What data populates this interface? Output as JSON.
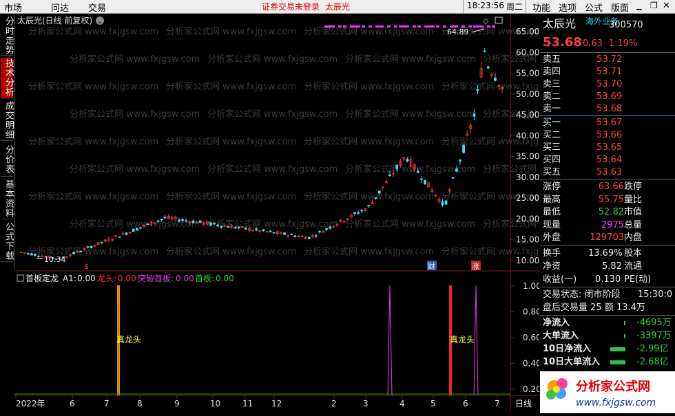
{
  "menu": {
    "left": [
      "市场",
      "问达",
      "交易"
    ],
    "notice": "证券交易未登录",
    "stock_name_top": "太辰光",
    "time": "18:23:56",
    "weekday": "周二",
    "right": [
      "功能",
      "选项",
      "公式",
      "版面"
    ]
  },
  "left_tabs": [
    "分时走势",
    "技术分析",
    "成交明细",
    "分价表",
    "基本资料",
    "公式下载"
  ],
  "chart": {
    "title": "太辰光(日线 前复权)",
    "max_label": "64.89",
    "min_label": "10.34",
    "y_ticks": [
      "65.00",
      "60.00",
      "55.00",
      "50.00",
      "45.00",
      "40.00",
      "35.00",
      "30.00",
      "25.00",
      "20.00",
      "15.00",
      "10.00"
    ],
    "markers": {
      "s": "$",
      "cai": "财",
      "zhang": "涨"
    },
    "watermark": "分析家公式网 www.fxjgsw.com",
    "indicator": {
      "name": "首板定龙",
      "a1_label": "A1:",
      "a1_value": "0.00",
      "longtou_label": "龙头:",
      "longtou_value": "0.00",
      "tupo_label": "突破首板:",
      "tupo_value": "0.00",
      "shouban_label": "首板:",
      "shouban_value": "0.00",
      "y_ticks": [
        "1.00",
        "0.80",
        "0.60",
        "0.40",
        "0.20"
      ],
      "event_label": "真龙头"
    },
    "x_ticks": [
      "2022年",
      "6",
      "7",
      "8",
      "9",
      "10",
      "11",
      "12",
      "2",
      "3",
      "4",
      "5",
      "6",
      "7"
    ],
    "period": "日线",
    "chart_data": {
      "type": "candlestick",
      "ylim": [
        9,
        66
      ],
      "price_max": 64.89,
      "price_min": 10.34,
      "dragon_events": 2
    }
  },
  "panel": {
    "name": "太辰光",
    "tag": "海外业务",
    "code": "300570",
    "price": "53.68",
    "change": "0.63",
    "change_pct": "1.19%",
    "sells": [
      {
        "label": "卖五",
        "price": "53.72"
      },
      {
        "label": "卖四",
        "price": "53.71"
      },
      {
        "label": "卖三",
        "price": "53.70"
      },
      {
        "label": "卖二",
        "price": "53.69"
      },
      {
        "label": "卖一",
        "price": "53.68"
      }
    ],
    "buys": [
      {
        "label": "买一",
        "price": "53.67"
      },
      {
        "label": "买二",
        "price": "53.66"
      },
      {
        "label": "买三",
        "price": "53.65"
      },
      {
        "label": "买四",
        "price": "53.64"
      },
      {
        "label": "买五",
        "price": "53.63"
      }
    ],
    "stats": [
      {
        "k": "涨停",
        "v": "63.66",
        "k2": "跌停"
      },
      {
        "k": "最高",
        "v": "55.75",
        "k2": "量比"
      },
      {
        "k": "最低",
        "v": "52.82",
        "k2": "市值"
      },
      {
        "k": "现量",
        "v": "2975",
        "k2": "总量"
      },
      {
        "k": "外盘",
        "v": "129703",
        "k2": "内盘"
      }
    ],
    "turnover": {
      "k": "换手",
      "v": "13.69%",
      "k2": "股本"
    },
    "netasset": {
      "k": "净资",
      "v": "5.82",
      "k2": "流通"
    },
    "eps": {
      "k": "收益(一)",
      "v": "0.130",
      "k2": "PE(动)"
    },
    "trade_state": "交易状态: 闭市阶段",
    "trade_time": "15:30:0",
    "after_hours": "盘后交易量 25 额 13.4万",
    "flows": [
      {
        "k": "净流入",
        "v": "-4695万"
      },
      {
        "k": "大单流入",
        "v": "-3397万"
      },
      {
        "k": "10日净流入",
        "v": "-2.99亿"
      },
      {
        "k": "10日大单流入",
        "v": "-2.68亿"
      }
    ]
  },
  "logo": {
    "name": "分析家公式网",
    "url": "www.fxjgsw.com"
  }
}
